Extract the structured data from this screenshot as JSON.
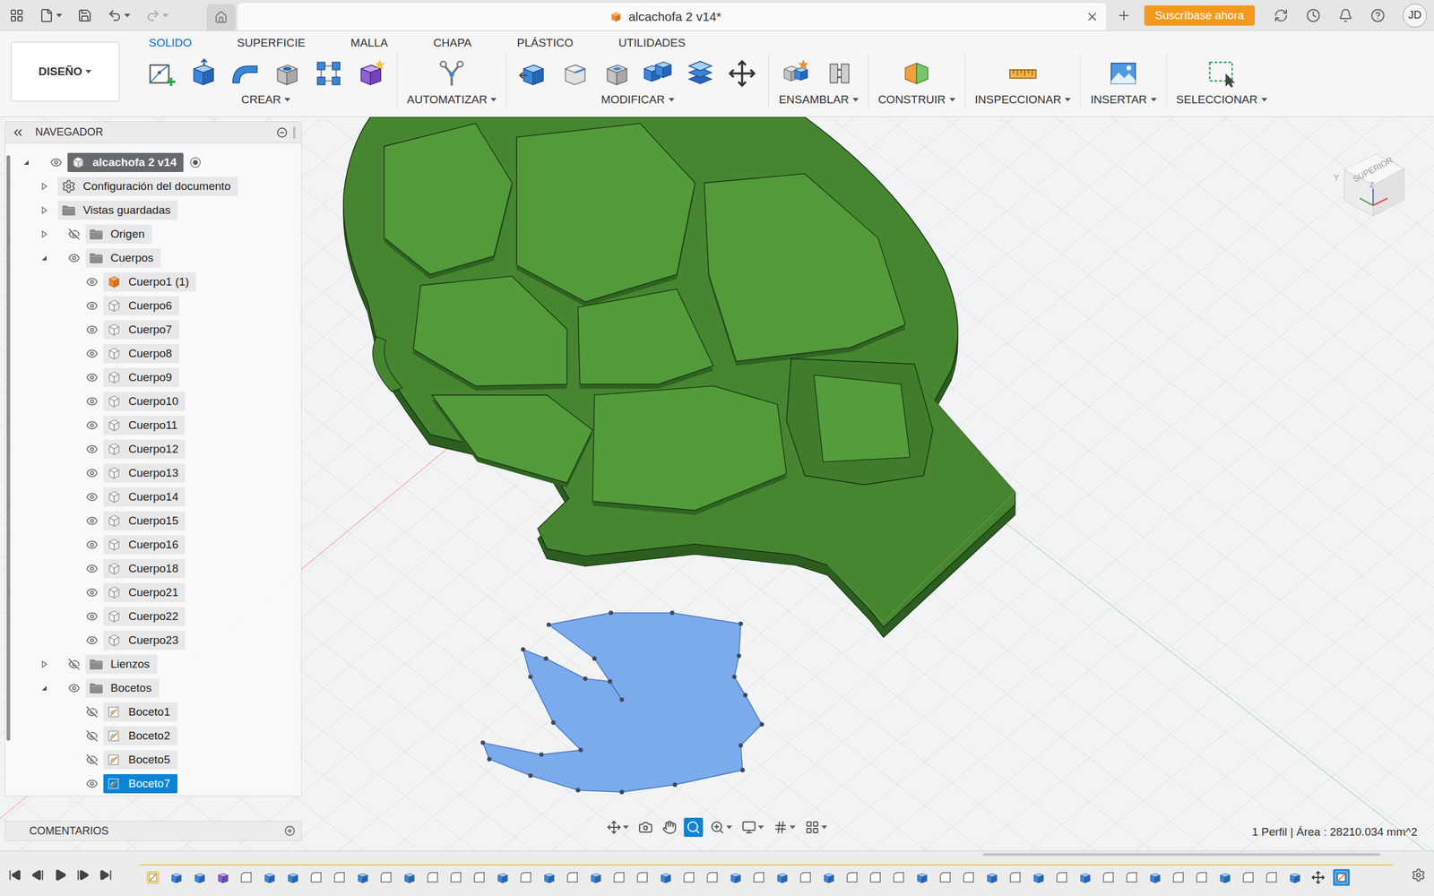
{
  "window": {
    "title": "alcachofa 2 v14*"
  },
  "title_bar": {
    "subscribe": "Suscríbase ahora",
    "avatar": "JD"
  },
  "workspace": {
    "label": "DISEÑO"
  },
  "tabs": [
    {
      "label": "SOLIDO",
      "selected": true
    },
    {
      "label": "SUPERFICIE",
      "selected": false
    },
    {
      "label": "MALLA",
      "selected": false
    },
    {
      "label": "CHAPA",
      "selected": false
    },
    {
      "label": "PLÁSTICO",
      "selected": false
    },
    {
      "label": "UTILIDADES",
      "selected": false
    }
  ],
  "toolbar_groups": [
    {
      "label": "CREAR",
      "tools": [
        {
          "kind": "sketch"
        },
        {
          "kind": "extrude"
        },
        {
          "kind": "sweep"
        },
        {
          "kind": "hole"
        },
        {
          "kind": "pattern"
        },
        {
          "kind": "form"
        }
      ]
    },
    {
      "label": "AUTOMATIZAR",
      "tools": [
        {
          "kind": "automate"
        }
      ]
    },
    {
      "label": "MODIFICAR",
      "tools": [
        {
          "kind": "presspull"
        },
        {
          "kind": "fillet"
        },
        {
          "kind": "shell"
        },
        {
          "kind": "combine"
        },
        {
          "kind": "replace"
        },
        {
          "kind": "move"
        }
      ]
    },
    {
      "label": "ENSAMBLAR",
      "tools": [
        {
          "kind": "joint"
        },
        {
          "kind": "asbuilt"
        }
      ]
    },
    {
      "label": "CONSTRUIR",
      "tools": [
        {
          "kind": "plane"
        }
      ]
    },
    {
      "label": "INSPECCIONAR",
      "tools": [
        {
          "kind": "measure"
        }
      ]
    },
    {
      "label": "INSERTAR",
      "tools": [
        {
          "kind": "image"
        }
      ]
    },
    {
      "label": "SELECCIONAR",
      "tools": [
        {
          "kind": "select"
        }
      ]
    }
  ],
  "navigator": {
    "title": "NAVEGADOR",
    "items": [
      {
        "label": "alcachofa 2 v14",
        "kind": "component",
        "level": 0,
        "expanded": true,
        "visible": true,
        "selected": false,
        "active": true
      },
      {
        "label": "Configuración del documento",
        "kind": "settings",
        "level": 1,
        "expanded": false,
        "selected": false
      },
      {
        "label": "Vistas guardadas",
        "kind": "folder",
        "level": 1,
        "expanded": false,
        "selected": false
      },
      {
        "label": "Origen",
        "kind": "folder",
        "level": 1,
        "expanded": false,
        "visible": false,
        "selected": false
      },
      {
        "label": "Cuerpos",
        "kind": "folder",
        "level": 1,
        "expanded": true,
        "visible": true,
        "selected": false
      },
      {
        "label": "Cuerpo1 (1)",
        "kind": "linked-body",
        "level": 2,
        "visible": true,
        "selected": false
      },
      {
        "label": "Cuerpo6",
        "kind": "body",
        "level": 2,
        "visible": true,
        "selected": false
      },
      {
        "label": "Cuerpo7",
        "kind": "body",
        "level": 2,
        "visible": true,
        "selected": false
      },
      {
        "label": "Cuerpo8",
        "kind": "body",
        "level": 2,
        "visible": true,
        "selected": false
      },
      {
        "label": "Cuerpo9",
        "kind": "body",
        "level": 2,
        "visible": true,
        "selected": false
      },
      {
        "label": "Cuerpo10",
        "kind": "body",
        "level": 2,
        "visible": true,
        "selected": false
      },
      {
        "label": "Cuerpo11",
        "kind": "body",
        "level": 2,
        "visible": true,
        "selected": false
      },
      {
        "label": "Cuerpo12",
        "kind": "body",
        "level": 2,
        "visible": true,
        "selected": false
      },
      {
        "label": "Cuerpo13",
        "kind": "body",
        "level": 2,
        "visible": true,
        "selected": false
      },
      {
        "label": "Cuerpo14",
        "kind": "body",
        "level": 2,
        "visible": true,
        "selected": false
      },
      {
        "label": "Cuerpo15",
        "kind": "body",
        "level": 2,
        "visible": true,
        "selected": false
      },
      {
        "label": "Cuerpo16",
        "kind": "body",
        "level": 2,
        "visible": true,
        "selected": false
      },
      {
        "label": "Cuerpo18",
        "kind": "body",
        "level": 2,
        "visible": true,
        "selected": false
      },
      {
        "label": "Cuerpo21",
        "kind": "body",
        "level": 2,
        "visible": true,
        "selected": false
      },
      {
        "label": "Cuerpo22",
        "kind": "body",
        "level": 2,
        "visible": true,
        "selected": false
      },
      {
        "label": "Cuerpo23",
        "kind": "body",
        "level": 2,
        "visible": true,
        "selected": false
      },
      {
        "label": "Lienzos",
        "kind": "folder",
        "level": 1,
        "expanded": false,
        "visible": false,
        "selected": false
      },
      {
        "label": "Bocetos",
        "kind": "folder",
        "level": 1,
        "expanded": true,
        "visible": true,
        "selected": false
      },
      {
        "label": "Boceto1",
        "kind": "sketch",
        "level": 2,
        "visible": false,
        "selected": false
      },
      {
        "label": "Boceto2",
        "kind": "sketch",
        "level": 2,
        "visible": false,
        "selected": false
      },
      {
        "label": "Boceto5",
        "kind": "sketch",
        "level": 2,
        "visible": false,
        "selected": false
      },
      {
        "label": "Boceto7",
        "kind": "sketch",
        "level": 2,
        "visible": true,
        "selected": true
      }
    ]
  },
  "comments": {
    "title": "COMENTARIOS"
  },
  "viewcube": {
    "face": "SUPERIOR",
    "axes": [
      "Y",
      "Z"
    ]
  },
  "view_tools": [
    {
      "kind": "orbit",
      "selected": false,
      "menu": true
    },
    {
      "kind": "look",
      "selected": false,
      "menu": false
    },
    {
      "kind": "pan",
      "selected": false,
      "menu": false
    },
    {
      "kind": "zoom",
      "selected": true,
      "menu": false
    },
    {
      "kind": "fit",
      "selected": false,
      "menu": true
    },
    {
      "kind": "display",
      "selected": false,
      "menu": true
    },
    {
      "kind": "grid",
      "selected": false,
      "menu": true
    },
    {
      "kind": "viewports",
      "selected": false,
      "menu": true
    }
  ],
  "status": "1 Perfil | Área : 28210.034 mm^2",
  "timeline": {
    "features": [
      {
        "kind": "sketch",
        "selected": false
      },
      {
        "kind": "extrude",
        "selected": false
      },
      {
        "kind": "extrude",
        "selected": false
      },
      {
        "kind": "form",
        "selected": false
      },
      {
        "kind": "fillet",
        "selected": false
      },
      {
        "kind": "extrude",
        "selected": false
      },
      {
        "kind": "extrude",
        "selected": false
      },
      {
        "kind": "fillet",
        "selected": false
      },
      {
        "kind": "fillet",
        "selected": false
      },
      {
        "kind": "extrude",
        "selected": false
      },
      {
        "kind": "fillet",
        "selected": false
      },
      {
        "kind": "extrude",
        "selected": false
      },
      {
        "kind": "fillet",
        "selected": false
      },
      {
        "kind": "fillet",
        "selected": false
      },
      {
        "kind": "fillet",
        "selected": false
      },
      {
        "kind": "extrude",
        "selected": false
      },
      {
        "kind": "fillet",
        "selected": false
      },
      {
        "kind": "extrude",
        "selected": false
      },
      {
        "kind": "fillet",
        "selected": false
      },
      {
        "kind": "extrude",
        "selected": false
      },
      {
        "kind": "fillet",
        "selected": false
      },
      {
        "kind": "fillet",
        "selected": false
      },
      {
        "kind": "extrude",
        "selected": false
      },
      {
        "kind": "fillet",
        "selected": false
      },
      {
        "kind": "fillet",
        "selected": false
      },
      {
        "kind": "extrude",
        "selected": false
      },
      {
        "kind": "fillet",
        "selected": false
      },
      {
        "kind": "extrude",
        "selected": false
      },
      {
        "kind": "fillet",
        "selected": false
      },
      {
        "kind": "extrude",
        "selected": false
      },
      {
        "kind": "fillet",
        "selected": false
      },
      {
        "kind": "fillet",
        "selected": false
      },
      {
        "kind": "fillet",
        "selected": false
      },
      {
        "kind": "extrude",
        "selected": false
      },
      {
        "kind": "fillet",
        "selected": false
      },
      {
        "kind": "fillet",
        "selected": false
      },
      {
        "kind": "extrude",
        "selected": false
      },
      {
        "kind": "fillet",
        "selected": false
      },
      {
        "kind": "extrude",
        "selected": false
      },
      {
        "kind": "fillet",
        "selected": false
      },
      {
        "kind": "extrude",
        "selected": false
      },
      {
        "kind": "fillet",
        "selected": false
      },
      {
        "kind": "fillet",
        "selected": false
      },
      {
        "kind": "extrude",
        "selected": false
      },
      {
        "kind": "fillet",
        "selected": false
      },
      {
        "kind": "fillet",
        "selected": false
      },
      {
        "kind": "extrude",
        "selected": false
      },
      {
        "kind": "fillet",
        "selected": false
      },
      {
        "kind": "fillet",
        "selected": false
      },
      {
        "kind": "extrude",
        "selected": false
      },
      {
        "kind": "move",
        "selected": false
      },
      {
        "kind": "sketch",
        "selected": true
      }
    ]
  }
}
